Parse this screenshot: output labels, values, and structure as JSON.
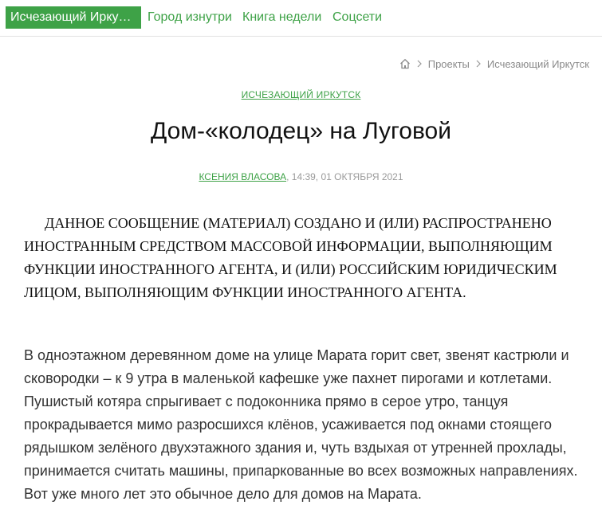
{
  "nav": {
    "active_label": "Исчезающий Ирку…",
    "links": [
      "Город изнутри",
      "Книга недели",
      "Соцсети"
    ]
  },
  "breadcrumb": {
    "items": [
      "Проекты",
      "Исчезающий Иркутск"
    ]
  },
  "article": {
    "category": "ИСЧЕЗАЮЩИЙ ИРКУТСК",
    "title": "Дом-«колодец» на Луговой",
    "author": "КСЕНИЯ ВЛАСОВА",
    "datetime": ", 14:39, 01 ОКТЯБРЯ 2021",
    "disclaimer": "ДАННОЕ СООБЩЕНИЕ (МАТЕРИАЛ) СОЗДАНО И (ИЛИ) РАСПРОСТРАНЕНО ИНОСТРАННЫМ СРЕДСТВОМ МАССОВОЙ ИНФОРМАЦИИ, ВЫПОЛНЯЮЩИМ ФУНКЦИИ ИНОСТРАННОГО АГЕНТА, И (ИЛИ) РОССИЙСКИМ ЮРИДИЧЕСКИМ ЛИЦОМ, ВЫПОЛНЯЮЩИМ ФУНКЦИИ ИНОСТРАННОГО АГЕНТА.",
    "paragraph": "В одноэтажном деревянном доме на улице Марата горит свет, звенят кастрюли и сковородки – к 9 утра в маленькой кафешке уже пахнет пирогами и котлетами. Пушистый котяра спрыгивает с подоконника прямо в серое утро, танцуя прокрадывается мимо разросшихся клёнов, усаживается под окнами стоящего рядышком зелёного двухэтажного здания и, чуть вздыхая от утренней прохлады, принимается считать машины, припаркованные во всех возможных направлениях. Вот уже много лет это обычное дело для домов на Марата."
  },
  "colors": {
    "accent": "#3ea247",
    "muted": "#8a8a8a"
  },
  "icons": [
    "home-icon",
    "chevron-right-icon"
  ]
}
